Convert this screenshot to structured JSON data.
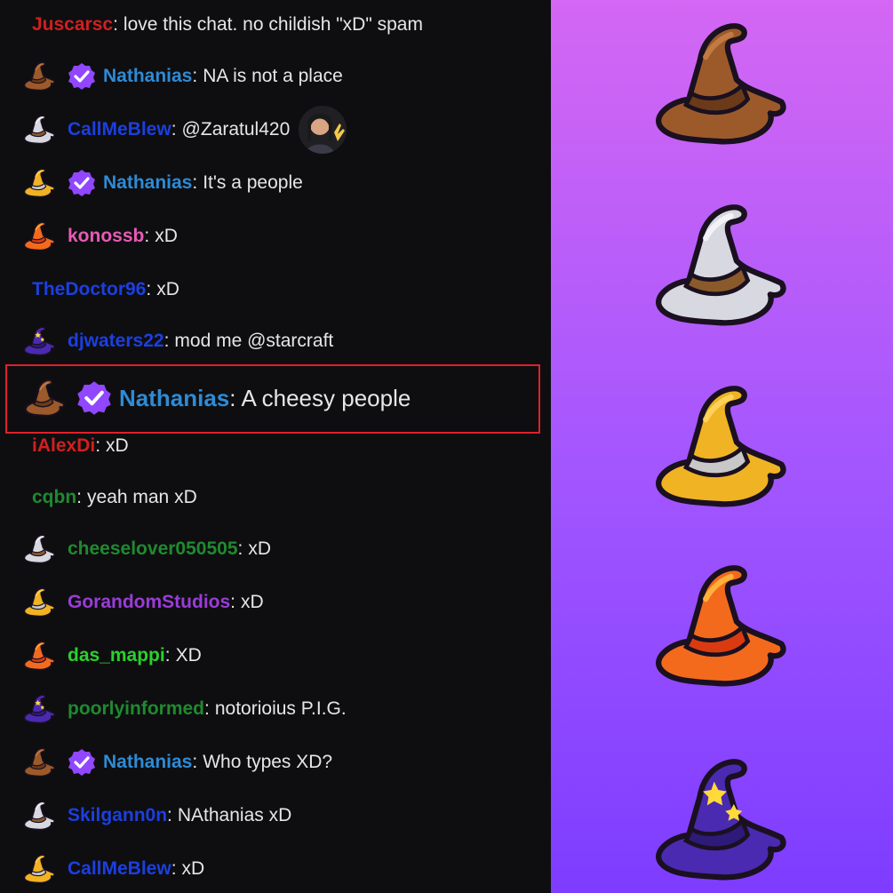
{
  "chat": {
    "messages": [
      {
        "user": "Juscarsc",
        "color": "#d21f1f",
        "text": "love this chat. no childish \"xD\" spam",
        "hat": null,
        "verified": false
      },
      {
        "user": "Nathanias",
        "color": "#2e8bd6",
        "text": "NA is not a place",
        "hat": "brown-hat-icon",
        "verified": true
      },
      {
        "user": "CallMeBlew",
        "color": "#1c3fe0",
        "text": "@Zaratul420",
        "hat": "white-hat-icon",
        "verified": false,
        "emote": "waving-woman-emote"
      },
      {
        "user": "Nathanias",
        "color": "#2e8bd6",
        "text": "It's a people",
        "hat": "gold-hat-icon",
        "verified": true
      },
      {
        "user": "konossb",
        "color": "#e65bb5",
        "text": "xD",
        "hat": "fire-hat-icon",
        "verified": false
      },
      {
        "user": "TheDoctor96",
        "color": "#1c3fe0",
        "text": "xD",
        "hat": null,
        "verified": false
      },
      {
        "user": "djwaters22",
        "color": "#1c3fe0",
        "text": "mod me @starcraft",
        "hat": "purple-star-hat-icon",
        "verified": false
      },
      {
        "user": "Nathanias",
        "color": "#2e8bd6",
        "text": "A cheesy people",
        "hat": "brown-hat-icon",
        "verified": true,
        "highlighted": true
      },
      {
        "user": "iAlexDi",
        "color": "#d21f1f",
        "text": "xD",
        "hat": null,
        "verified": false
      },
      {
        "user": "cqbn",
        "color": "#1f8a2f",
        "text": "yeah man xD",
        "hat": null,
        "verified": false
      },
      {
        "user": "cheeselover050505",
        "color": "#1f8a2f",
        "text": "xD",
        "hat": "white-hat-icon",
        "verified": false
      },
      {
        "user": "GorandomStudios",
        "color": "#9a3cd8",
        "text": "xD",
        "hat": "gold-hat-icon",
        "verified": false
      },
      {
        "user": "das_mappi",
        "color": "#2bd12b",
        "text": "XD",
        "hat": "fire-hat-icon",
        "verified": false
      },
      {
        "user": "poorlyinformed",
        "color": "#1f8a2f",
        "text": "notorioius P.I.G.",
        "hat": "purple-star-hat-icon",
        "verified": false
      },
      {
        "user": "Nathanias",
        "color": "#2e8bd6",
        "text": "Who types XD?",
        "hat": "brown-hat-icon",
        "verified": true
      },
      {
        "user": "Skilgann0n",
        "color": "#1c3fe0",
        "text": "NAthanias xD",
        "hat": "white-hat-icon",
        "verified": false
      },
      {
        "user": "CallMeBlew",
        "color": "#1c3fe0",
        "text": "xD",
        "hat": "gold-hat-icon",
        "verified": false
      }
    ],
    "highlight_border_color": "#e0202a"
  },
  "hats_panel": {
    "hats": [
      "brown-hat-icon",
      "white-hat-icon",
      "gold-hat-icon",
      "fire-hat-icon",
      "purple-star-hat-icon"
    ],
    "gradient": [
      "#d467f3",
      "#a155ff",
      "#7d3cff"
    ]
  },
  "colors": {
    "chat_bg": "#0e0e10",
    "text": "#e6e6e6",
    "verified_badge": "#9147ff"
  }
}
